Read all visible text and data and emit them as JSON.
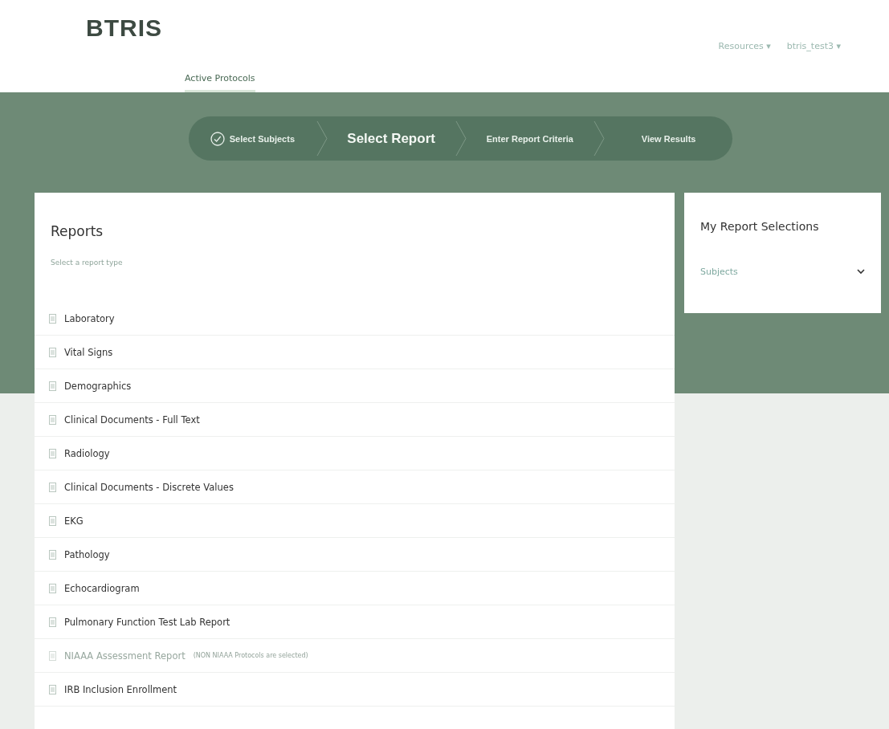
{
  "header": {
    "logo": "BTRIS",
    "nav": [
      {
        "label": "Active Protocols",
        "selected": true
      }
    ],
    "menus": [
      {
        "label": "Resources",
        "caret": "▾"
      },
      {
        "label": "btris_test3",
        "caret": "▾"
      }
    ]
  },
  "steps": [
    {
      "label": "Select Subjects",
      "done": true,
      "selected": false
    },
    {
      "label": "Select Report",
      "done": false,
      "selected": true
    },
    {
      "label": "Enter Report Criteria",
      "done": false,
      "selected": false
    },
    {
      "label": "View Results",
      "done": false,
      "selected": false
    }
  ],
  "reports": {
    "title": "Reports",
    "placeholder": "Select a report type",
    "items": [
      {
        "label": "Laboratory",
        "disabled": false
      },
      {
        "label": "Vital Signs",
        "disabled": false
      },
      {
        "label": "Demographics",
        "disabled": false
      },
      {
        "label": "Clinical Documents - Full Text",
        "disabled": false
      },
      {
        "label": "Radiology",
        "disabled": false
      },
      {
        "label": "Clinical Documents - Discrete Values",
        "disabled": false
      },
      {
        "label": "EKG",
        "disabled": false
      },
      {
        "label": "Pathology",
        "disabled": false
      },
      {
        "label": "Echocardiogram",
        "disabled": false
      },
      {
        "label": "Pulmonary Function Test Lab Report",
        "disabled": false
      },
      {
        "label": "NIAAA Assessment Report",
        "note": "(NON NIAAA Protocols are selected)",
        "disabled": true
      },
      {
        "label": "IRB Inclusion Enrollment",
        "disabled": false
      }
    ]
  },
  "selections": {
    "title": "My Report Selections",
    "sections": [
      {
        "label": "Subjects",
        "expanded": false
      }
    ]
  }
}
